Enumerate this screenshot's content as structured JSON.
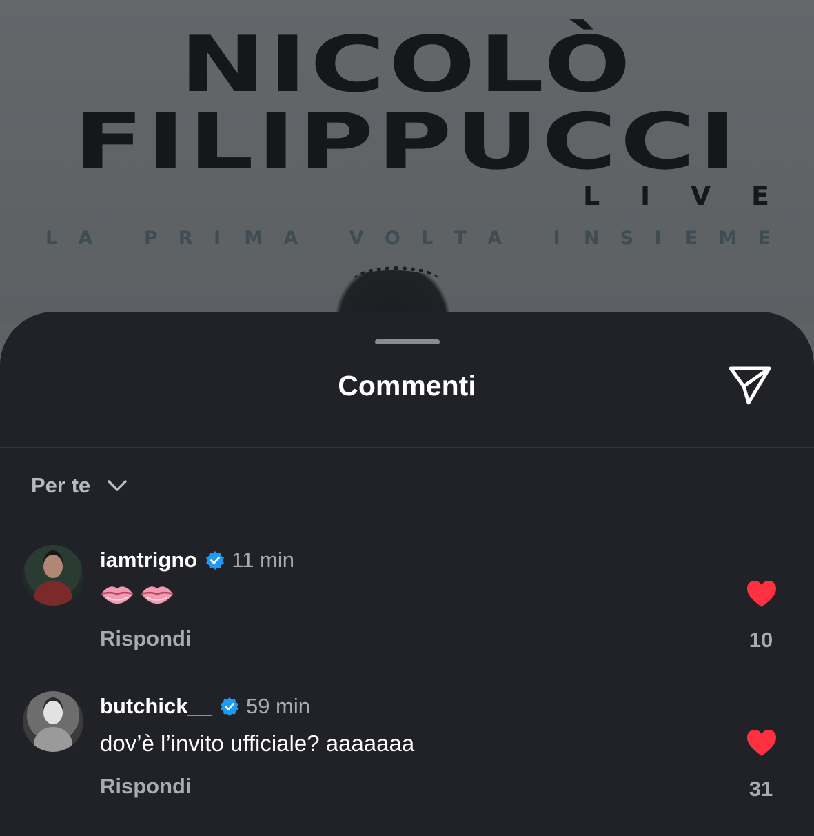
{
  "poster": {
    "title_line1": "NICOLÒ",
    "title_line2": "FILIPPUCCI",
    "live_letters": [
      "L",
      "I",
      "V",
      "E"
    ],
    "subtitle_letters": [
      "L",
      "A",
      " ",
      "P",
      "R",
      "I",
      "M",
      "A",
      " ",
      "V",
      "O",
      "L",
      "T",
      "A",
      " ",
      "I",
      "N",
      "S",
      "I",
      "E",
      "M",
      "E"
    ]
  },
  "sheet": {
    "title": "Commenti",
    "share_icon": "send-icon",
    "sort_label": "Per te"
  },
  "comments": [
    {
      "username": "iamtrigno",
      "verified": true,
      "time": "11 min",
      "text_emoji": "lips-emoji",
      "reply_label": "Rispondi",
      "likes": "10",
      "liked": true
    },
    {
      "username": "butchick__",
      "verified": true,
      "time": "59 min",
      "text": "dov’è l’invito ufficiale? aaaaaaa",
      "reply_label": "Rispondi",
      "likes": "31",
      "liked": true
    }
  ],
  "colors": {
    "sheet_bg": "#212227",
    "like_red": "#ff3040",
    "verified_blue": "#1d9bf0"
  }
}
